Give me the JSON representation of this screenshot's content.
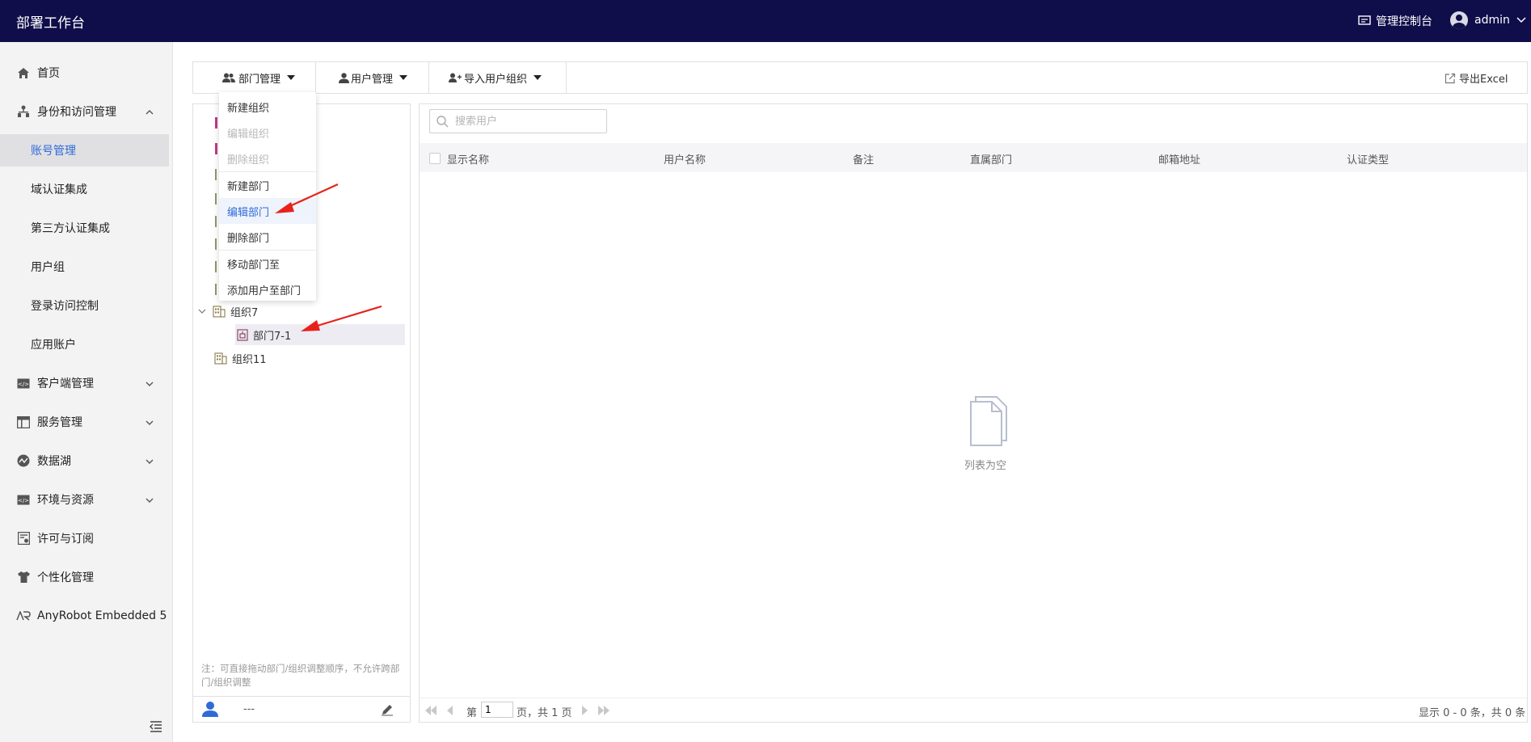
{
  "header": {
    "app_title": "部署工作台",
    "console_label": "管理控制台",
    "user_name": "admin"
  },
  "sidebar": {
    "items": [
      {
        "label": "首页",
        "icon": "home-icon"
      },
      {
        "label": "身份和访问管理",
        "icon": "org-icon",
        "expanded": true
      },
      {
        "label": "账号管理",
        "sub": true,
        "active": true
      },
      {
        "label": "域认证集成",
        "sub": true
      },
      {
        "label": "第三方认证集成",
        "sub": true
      },
      {
        "label": "用户组",
        "sub": true
      },
      {
        "label": "登录访问控制",
        "sub": true
      },
      {
        "label": "应用账户",
        "sub": true
      },
      {
        "label": "客户端管理",
        "icon": "code-icon"
      },
      {
        "label": "服务管理",
        "icon": "layout-icon"
      },
      {
        "label": "数据湖",
        "icon": "datalake-icon"
      },
      {
        "label": "环境与资源",
        "icon": "code-icon"
      },
      {
        "label": "许可与订阅",
        "icon": "license-icon"
      },
      {
        "label": "个性化管理",
        "icon": "shirt-icon"
      },
      {
        "label": "AnyRobot Embedded 5",
        "icon": "anyrobot-icon"
      }
    ]
  },
  "toolbar": {
    "dept_mgmt": "部门管理",
    "user_mgmt": "用户管理",
    "import": "导入用户组织",
    "export": "导出Excel"
  },
  "dropdown": {
    "items": [
      {
        "label": "新建组织",
        "disabled": false
      },
      {
        "label": "编辑组织",
        "disabled": true
      },
      {
        "label": "删除组织",
        "disabled": true
      },
      {
        "label": "新建部门",
        "disabled": false
      },
      {
        "label": "编辑部门",
        "disabled": false,
        "hover": true
      },
      {
        "label": "删除部门",
        "disabled": false
      },
      {
        "label": "移动部门至",
        "disabled": false
      },
      {
        "label": "添加用户至部门",
        "disabled": false
      }
    ]
  },
  "tree": {
    "org7": "组织7",
    "dept7_1": "部门7-1",
    "org11": "组织11",
    "note": "注：可直接拖动部门/组织调整顺序，不允许跨部门/组织调整",
    "footer_value": "---"
  },
  "search": {
    "placeholder": "搜索用户"
  },
  "table": {
    "columns": [
      "显示名称",
      "用户名称",
      "备注",
      "直属部门",
      "邮箱地址",
      "认证类型"
    ],
    "empty_text": "列表为空"
  },
  "pager": {
    "prefix": "第",
    "page": "1",
    "suffix": "页，共 1 页",
    "summary": "显示 0 - 0 条，共 0 条"
  }
}
